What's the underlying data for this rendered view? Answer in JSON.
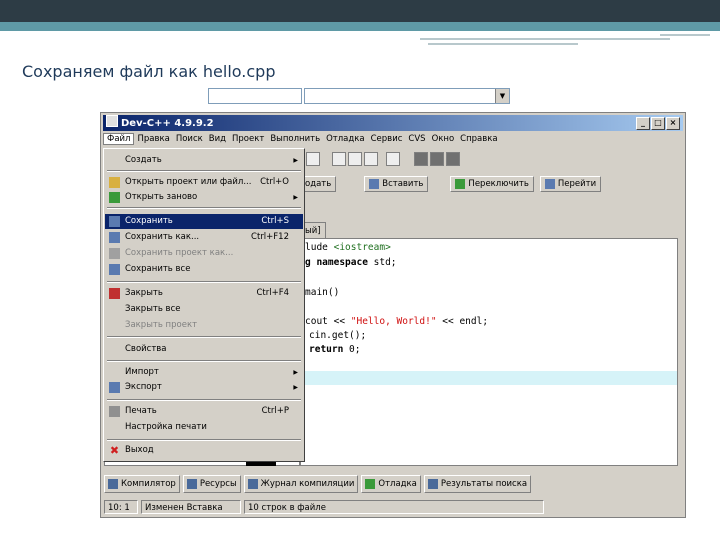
{
  "slide_title": "Сохраняем файл как hello.cpp",
  "window": {
    "title": "Dev-C++ 4.9.9.2",
    "buttons": {
      "minimize": "_",
      "maximize": "□",
      "close": "×"
    }
  },
  "menubar": [
    "Файл",
    "Правка",
    "Поиск",
    "Вид",
    "Проект",
    "Выполнить",
    "Отладка",
    "Сервис",
    "CVS",
    "Окно",
    "Справка"
  ],
  "toolbar2": [
    {
      "label": "одать",
      "icon": "new-icon"
    },
    {
      "label": "Вставить",
      "icon": "insert-icon"
    },
    {
      "label": "Переключить",
      "icon": "toggle-icon"
    },
    {
      "label": "Перейти",
      "icon": "goto-icon"
    }
  ],
  "tab_label": "ый]",
  "code_lines": [
    {
      "pre": "lude ",
      "inc": "<iostream>",
      "post": ""
    },
    {
      "kw": "g namespace",
      "post": " std;"
    },
    {
      "post": "main()"
    },
    {
      "pre": "cout << ",
      "str": "\"Hello, World!\"",
      "post": " << endl;"
    },
    {
      "post": "cin.get();"
    },
    {
      "kw": "return",
      "post": " 0;"
    }
  ],
  "file_menu": [
    {
      "label": "Создать",
      "submenu": true
    },
    {
      "label": "Открыть проект или файл...",
      "shortcut": "Ctrl+O"
    },
    {
      "label": "Открыть заново",
      "submenu": true
    },
    {
      "label": "Сохранить",
      "shortcut": "Ctrl+S",
      "selected": true
    },
    {
      "label": "Сохранить как...",
      "shortcut": "Ctrl+F12"
    },
    {
      "label": "Сохранить проект как...",
      "disabled": true
    },
    {
      "label": "Сохранить все"
    },
    {
      "label": "Закрыть",
      "shortcut": "Ctrl+F4"
    },
    {
      "label": "Закрыть все"
    },
    {
      "label": "Закрыть проект",
      "disabled": true
    },
    {
      "label": "Свойства"
    },
    {
      "label": "Импорт",
      "submenu": true
    },
    {
      "label": "Экспорт",
      "submenu": true
    },
    {
      "label": "Печать",
      "shortcut": "Ctrl+P"
    },
    {
      "label": "Настройка печати"
    },
    {
      "label": "Выход"
    }
  ],
  "bottom_tabs": [
    "Компилятор",
    "Ресурсы",
    "Журнал компиляции",
    "Отладка",
    "Результаты поиска"
  ],
  "status": [
    "10: 1",
    "Изменен Вставка",
    "10 строк в файле"
  ],
  "colors": {
    "selection": "#0a246a",
    "highlight_line": "#d6f3f8",
    "string": "#d01010"
  }
}
